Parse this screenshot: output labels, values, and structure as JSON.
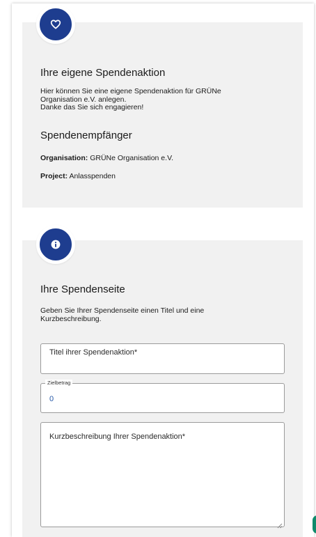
{
  "section1": {
    "icon": "heart-icon",
    "title": "Ihre eigene Spendenaktion",
    "description_lines": [
      "Hier können Sie eine eigene Spendenaktion für GRÜNe",
      "Organisation e.V. anlegen.",
      "Danke das Sie sich engagieren!"
    ],
    "recipient_heading": "Spendenempfänger",
    "organisation_label": "Organisation:",
    "organisation_value": "GRÜNe Organisation e.V.",
    "project_label": "Project:",
    "project_value": "Anlasspenden"
  },
  "section2": {
    "icon": "info-icon",
    "title": "Ihre Spendenseite",
    "description_lines": [
      "Geben Sie Ihrer Spendenseite einen Titel und eine",
      "Kurzbeschreibung."
    ],
    "title_field": {
      "placeholder": "Titel ihrer Spendenaktion*"
    },
    "goal_field": {
      "label": "Zielbetrag",
      "value": "0"
    },
    "description_field": {
      "placeholder": "Kurzbeschreibung Ihrer Spendenaktion*"
    }
  },
  "colors": {
    "accent": "#1e3d8f",
    "card_bg": "#f1f1f1",
    "value_blue": "#2557a7",
    "chat_green": "#0f8a6b"
  }
}
